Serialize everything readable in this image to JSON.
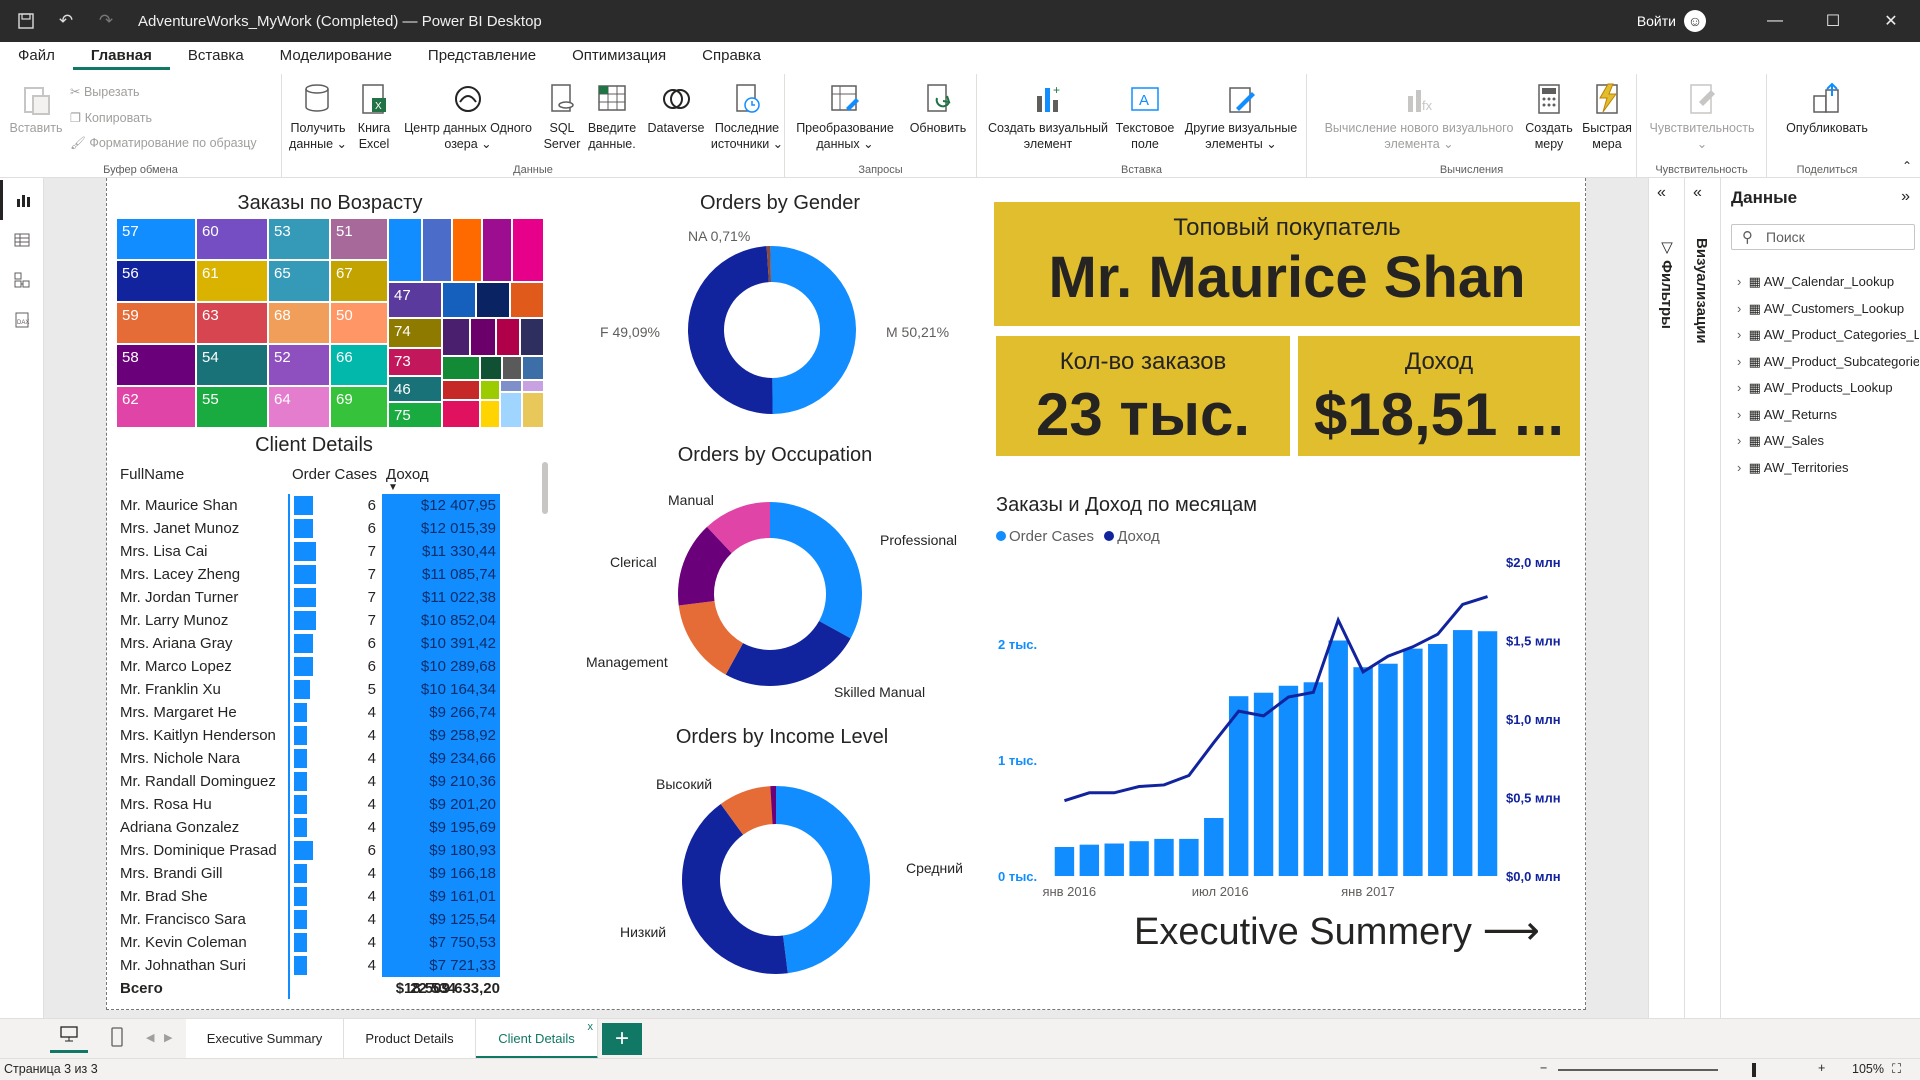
{
  "window": {
    "title": "AdventureWorks_MyWork (Completed) — Power BI Desktop",
    "sign_in": "Войти"
  },
  "menu": [
    "Файл",
    "Главная",
    "Вставка",
    "Моделирование",
    "Представление",
    "Оптимизация",
    "Справка"
  ],
  "ribbon": {
    "clipboard": {
      "label": "Буфер обмена",
      "paste": "Вставить",
      "cut": "Вырезать",
      "copy": "Копировать",
      "format": "Форматирование по образцу"
    },
    "data": {
      "label": "Данные",
      "get1": "Получить",
      "get2": "данные ⌄",
      "excel1": "Книга",
      "excel2": "Excel",
      "center1": "Центр данных Одного",
      "center2": "озера ⌄",
      "sql1": "SQL",
      "sql2": "Server",
      "enter1": "Введите",
      "enter2": "данные.",
      "dataverse": "Dataverse",
      "recent1": "Последние",
      "recent2": "источники ⌄"
    },
    "queries": {
      "label": "Запросы",
      "transform1": "Преобразование",
      "transform2": "данных ⌄",
      "refresh": "Обновить"
    },
    "insert": {
      "label": "Вставка",
      "visual1": "Создать визуальный",
      "visual2": "элемент",
      "text1": "Текстовое",
      "text2": "поле",
      "other1": "Другие визуальные",
      "other2": "элементы ⌄"
    },
    "calc": {
      "label": "Вычисления",
      "newcalc1": "Вычисление нового визуального",
      "newcalc2": "элемента ⌄",
      "measure1": "Создать",
      "measure2": "меру",
      "quick1": "Быстрая",
      "quick2": "мера"
    },
    "sens": {
      "label": "Чувствительность",
      "btn": "Чувствительность",
      "btn2": "⌄"
    },
    "share": {
      "label": "Поделиться",
      "publish": "Опубликовать"
    }
  },
  "visuals": {
    "treemap": {
      "title": "Заказы по Возрасту",
      "labels": [
        "57",
        "60",
        "53",
        "51",
        "56",
        "61",
        "65",
        "67",
        "59",
        "63",
        "68",
        "50",
        "58",
        "54",
        "52",
        "66",
        "62",
        "55",
        "64",
        "69",
        "47",
        "74",
        "73",
        "46",
        "75"
      ]
    },
    "gender": {
      "title": "Orders by Gender",
      "na": "NA 0,71%",
      "f": "F 49,09%",
      "m": "M 50,21%"
    },
    "occupation": {
      "title": "Orders by Occupation",
      "manual": "Manual",
      "professional": "Professional",
      "clerical": "Clerical",
      "management": "Management",
      "skilled": "Skilled Manual"
    },
    "income": {
      "title": "Orders by Income Level",
      "high": "Высокий",
      "mid": "Средний",
      "low": "Низкий"
    },
    "top_customer": {
      "title": "Топовый покупатель",
      "name": "Mr. Maurice Shan"
    },
    "orders_kpi": {
      "title": "Кол-во заказов",
      "value": "23 тыс."
    },
    "revenue_kpi": {
      "title": "Доход",
      "value": "$18,51 ..."
    },
    "combo": {
      "title": "Заказы и Доход по месяцам",
      "legend_orders": "Order Cases",
      "legend_revenue": "Доход",
      "y1_ticks": [
        "0 тыс.",
        "1 тыс.",
        "2 тыс."
      ],
      "y2_ticks": [
        "$0,0 млн",
        "$0,5 млн",
        "$1,0 млн",
        "$1,5 млн",
        "$2,0 млн"
      ],
      "x_ticks": [
        "янв 2016",
        "июл 2016",
        "янв 2017"
      ]
    },
    "exec_link": "Executive Summery"
  },
  "chart_data": [
    {
      "type": "pie",
      "title": "Orders by Gender",
      "categories": [
        "M",
        "F",
        "NA"
      ],
      "values": [
        50.21,
        49.09,
        0.71
      ]
    },
    {
      "type": "pie",
      "title": "Orders by Occupation",
      "categories": [
        "Professional",
        "Skilled Manual",
        "Management",
        "Clerical",
        "Manual"
      ],
      "values": [
        33,
        25,
        15,
        15,
        12
      ]
    },
    {
      "type": "pie",
      "title": "Orders by Income Level",
      "categories": [
        "Средний",
        "Низкий",
        "Высокий"
      ],
      "values": [
        48,
        42,
        10
      ]
    },
    {
      "type": "bar",
      "title": "Заказы и Доход по месяцам",
      "categories": [
        "2016-01",
        "2016-02",
        "2016-03",
        "2016-04",
        "2016-05",
        "2016-06",
        "2016-07",
        "2016-08",
        "2016-09",
        "2016-10",
        "2016-11",
        "2016-12",
        "2017-01",
        "2017-02",
        "2017-03",
        "2017-04",
        "2017-05",
        "2017-06"
      ],
      "series": [
        {
          "name": "Order Cases",
          "values": [
            250,
            270,
            280,
            300,
            320,
            320,
            500,
            1550,
            1580,
            1640,
            1670,
            2030,
            1800,
            1830,
            1960,
            2000,
            2120,
            2110
          ]
        },
        {
          "name": "Доход",
          "values": [
            0.48,
            0.53,
            0.53,
            0.57,
            0.58,
            0.64,
            0.85,
            1.05,
            1.02,
            1.14,
            1.17,
            1.63,
            1.3,
            1.4,
            1.46,
            1.54,
            1.73,
            1.78
          ]
        }
      ],
      "y1lim": [
        0,
        2000
      ],
      "y2lim": [
        0,
        2.0
      ]
    }
  ],
  "table": {
    "title": "Client Details",
    "headers": [
      "FullName",
      "Order Cases",
      "Доход"
    ],
    "rows": [
      [
        "Mr. Maurice Shan",
        "6",
        "$12 407,95"
      ],
      [
        "Mrs. Janet Munoz",
        "6",
        "$12 015,39"
      ],
      [
        "Mrs. Lisa Cai",
        "7",
        "$11 330,44"
      ],
      [
        "Mrs. Lacey Zheng",
        "7",
        "$11 085,74"
      ],
      [
        "Mr. Jordan Turner",
        "7",
        "$11 022,38"
      ],
      [
        "Mr. Larry Munoz",
        "7",
        "$10 852,04"
      ],
      [
        "Mrs. Ariana Gray",
        "6",
        "$10 391,42"
      ],
      [
        "Mr. Marco Lopez",
        "6",
        "$10 289,68"
      ],
      [
        "Mr. Franklin Xu",
        "5",
        "$10 164,34"
      ],
      [
        "Mrs. Margaret He",
        "4",
        "$9 266,74"
      ],
      [
        "Mrs. Kaitlyn Henderson",
        "4",
        "$9 258,92"
      ],
      [
        "Mrs. Nichole Nara",
        "4",
        "$9 234,66"
      ],
      [
        "Mr. Randall Dominguez",
        "4",
        "$9 210,36"
      ],
      [
        "Mrs. Rosa Hu",
        "4",
        "$9 201,20"
      ],
      [
        "Adriana Gonzalez",
        "4",
        "$9 195,69"
      ],
      [
        "Mrs. Dominique Prasad",
        "6",
        "$9 180,93"
      ],
      [
        "Mrs. Brandi Gill",
        "4",
        "$9 166,18"
      ],
      [
        "Mr. Brad She",
        "4",
        "$9 161,01"
      ],
      [
        "Mr. Francisco Sara",
        "4",
        "$9 125,54"
      ],
      [
        "Mr. Kevin Coleman",
        "4",
        "$7 750,53"
      ],
      [
        "Mr. Johnathan Suri",
        "4",
        "$7 721,33"
      ]
    ],
    "total": [
      "Всего",
      "22 534",
      "$18 509 633,20"
    ]
  },
  "tabs": [
    "Executive Summary",
    "Product Details",
    "Client Details"
  ],
  "status": {
    "page": "Страница 3 из 3",
    "zoom": "105%"
  },
  "panels": {
    "filters": "Фильтры",
    "visualizations": "Визуализации",
    "data_title": "Данные",
    "search_placeholder": "Поиск",
    "tables": [
      "AW_Calendar_Lookup",
      "AW_Customers_Lookup",
      "AW_Product_Categories_Lookup",
      "AW_Product_Subcategories_Lookup",
      "AW_Products_Lookup",
      "AW_Returns",
      "AW_Sales",
      "AW_Territories"
    ]
  },
  "colors": {
    "accent": "#117865",
    "blue": "#118dff",
    "navy": "#12239e",
    "gold": "#e0be2e"
  }
}
